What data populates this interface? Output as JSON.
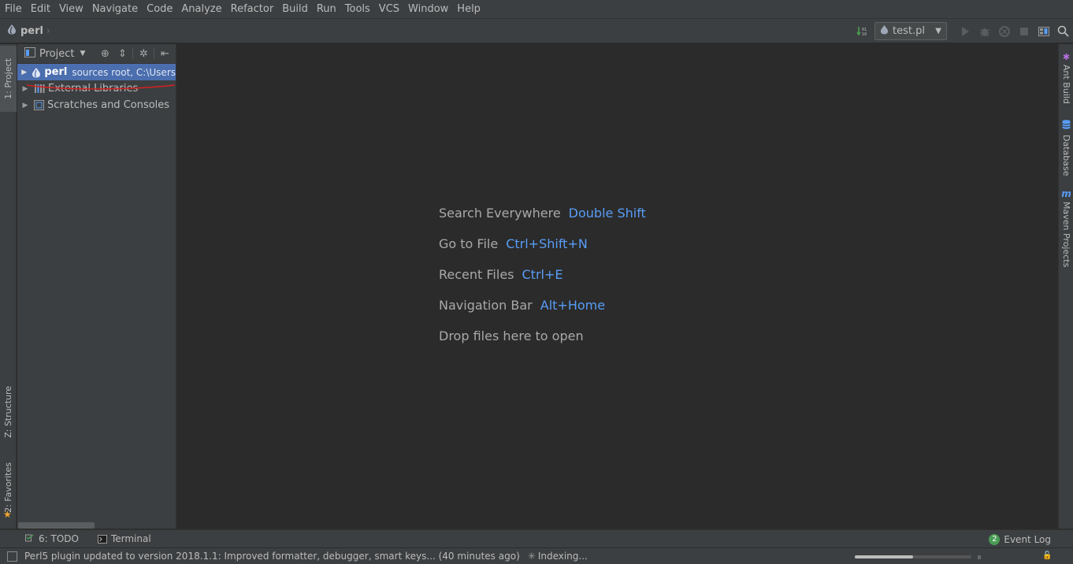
{
  "menu": [
    "File",
    "Edit",
    "View",
    "Navigate",
    "Code",
    "Analyze",
    "Refactor",
    "Build",
    "Run",
    "Tools",
    "VCS",
    "Window",
    "Help"
  ],
  "breadcrumb": {
    "project": "perl"
  },
  "run_config": {
    "label": "test.pl"
  },
  "left_tabs": {
    "project": "1: Project",
    "structure": "Z: Structure",
    "favorites": "2: Favorites"
  },
  "right_tabs": {
    "ant": "Ant Build",
    "database": "Database",
    "maven": "Maven Projects"
  },
  "project_panel": {
    "title": "Project",
    "tree": [
      {
        "name": "perl",
        "extra": "sources root,  C:\\Users",
        "selected": true
      },
      {
        "name": "External Libraries"
      },
      {
        "name": "Scratches and Consoles"
      }
    ]
  },
  "hints": [
    {
      "action": "Search Everywhere",
      "key": "Double Shift"
    },
    {
      "action": "Go to File",
      "key": "Ctrl+Shift+N"
    },
    {
      "action": "Recent Files",
      "key": "Ctrl+E"
    },
    {
      "action": "Navigation Bar",
      "key": "Alt+Home"
    },
    {
      "action": "Drop files here to open",
      "key": ""
    }
  ],
  "bottom_tabs": {
    "todo": "6: TODO",
    "terminal": "Terminal",
    "event_log": "Event Log",
    "event_count": "2"
  },
  "status": {
    "message": "Perl5 plugin updated to version 2018.1.1: Improved formatter, debugger, smart keys... (40 minutes ago)",
    "indexing": "Indexing...",
    "progress": 0.5
  },
  "colors": {
    "selection": "#4b6eaf",
    "key_hint": "#589df6",
    "background": "#2b2b2b",
    "panel": "#3c3f41"
  }
}
